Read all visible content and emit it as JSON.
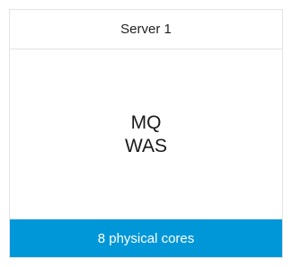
{
  "server": {
    "title": "Server 1",
    "components": [
      "MQ",
      "WAS"
    ],
    "footer_label": "8 physical cores"
  },
  "colors": {
    "footer_background": "#0097d8",
    "footer_text": "#ffffff",
    "border": "#e3e3e3"
  }
}
